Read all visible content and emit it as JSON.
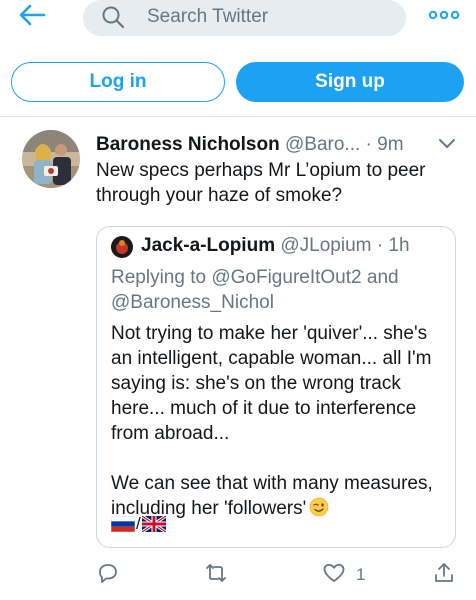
{
  "header": {
    "search_placeholder": "Search Twitter",
    "icons": {
      "back": "back-arrow-icon",
      "search": "search-icon",
      "more": "more-options-icon"
    }
  },
  "auth": {
    "login_label": "Log in",
    "signup_label": "Sign up"
  },
  "tweet": {
    "author_name": "Baroness Nicholson",
    "author_handle": "@Baro...",
    "time": "· 9m",
    "text": "New specs perhaps Mr L’opium to peer through your haze of smoke?",
    "quote": {
      "author_name": "Jack-a-Lopium",
      "author_handle": "@JLopium",
      "time": "· 1h",
      "replying_to": "Replying to",
      "reply_handle_1": "@GoFigureItOut2",
      "reply_and": "and",
      "reply_handle_2": "@Baroness_Nichol",
      "body_1": "Not trying to make her 'quiver'... she's an intelligent, capable woman... all I'm saying is: she's on the wrong track here... much of it due to interference from abroad...",
      "body_2": "We can see that with many measures, including her 'followers'",
      "flag_separator": "/"
    },
    "actions": {
      "like_count": "1"
    }
  },
  "colors": {
    "accent": "#1da1f2",
    "muted": "#657786",
    "border": "#ccd6dd",
    "search_bg": "#e6ecf0"
  }
}
